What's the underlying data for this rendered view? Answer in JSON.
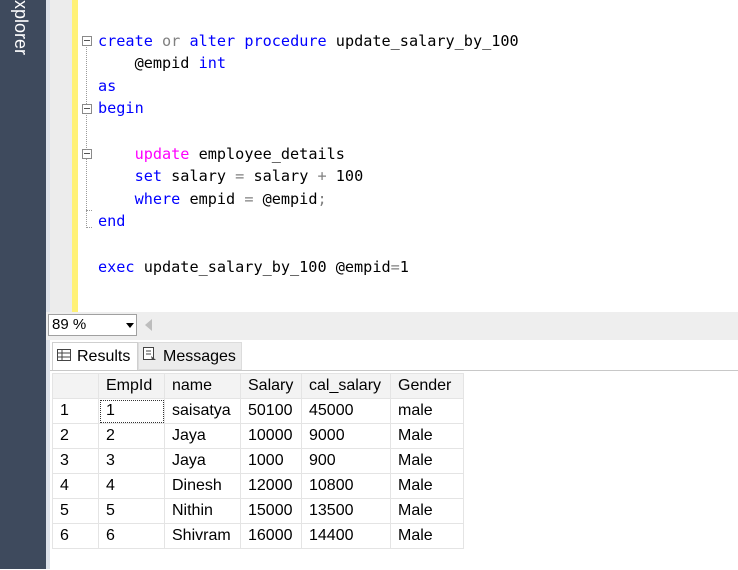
{
  "side_panel": {
    "label": "xplorer"
  },
  "editor": {
    "lines": [
      {
        "tokens": [
          {
            "t": "create",
            "c": "kw"
          },
          {
            "t": " "
          },
          {
            "t": "or",
            "c": "gr"
          },
          {
            "t": " "
          },
          {
            "t": "alter",
            "c": "kw"
          },
          {
            "t": " "
          },
          {
            "t": "procedure",
            "c": "kw"
          },
          {
            "t": " update_salary_by_100"
          }
        ]
      },
      {
        "tokens": [
          {
            "t": "    @empid "
          },
          {
            "t": "int",
            "c": "kw"
          }
        ]
      },
      {
        "tokens": [
          {
            "t": "as",
            "c": "kw"
          }
        ]
      },
      {
        "tokens": [
          {
            "t": "begin",
            "c": "kw"
          }
        ]
      },
      {
        "tokens": []
      },
      {
        "tokens": [
          {
            "t": "    "
          },
          {
            "t": "update",
            "c": "mg"
          },
          {
            "t": " employee_details"
          }
        ]
      },
      {
        "tokens": [
          {
            "t": "    "
          },
          {
            "t": "set",
            "c": "kw"
          },
          {
            "t": " salary "
          },
          {
            "t": "=",
            "c": "gr"
          },
          {
            "t": " salary "
          },
          {
            "t": "+",
            "c": "gr"
          },
          {
            "t": " 100"
          }
        ]
      },
      {
        "tokens": [
          {
            "t": "    "
          },
          {
            "t": "where",
            "c": "kw"
          },
          {
            "t": " empid "
          },
          {
            "t": "=",
            "c": "gr"
          },
          {
            "t": " @empid"
          },
          {
            "t": ";",
            "c": "gr"
          }
        ]
      },
      {
        "tokens": [
          {
            "t": "end",
            "c": "kw"
          }
        ]
      },
      {
        "tokens": []
      },
      {
        "tokens": [
          {
            "t": "exec",
            "c": "kw"
          },
          {
            "t": " update_salary_by_100 @empid"
          },
          {
            "t": "=",
            "c": "gr"
          },
          {
            "t": "1"
          }
        ]
      }
    ]
  },
  "zoom": {
    "value": "89 %"
  },
  "tabs": {
    "results": "Results",
    "messages": "Messages"
  },
  "grid": {
    "columns": [
      "EmpId",
      "name",
      "Salary",
      "cal_salary",
      "Gender"
    ],
    "rows": [
      [
        "1",
        "1",
        "saisatya",
        "50100",
        "45000",
        "male"
      ],
      [
        "2",
        "2",
        "Jaya",
        "10000",
        "9000",
        "Male"
      ],
      [
        "3",
        "3",
        "Jaya",
        "1000",
        "900",
        "Male"
      ],
      [
        "4",
        "4",
        "Dinesh",
        "12000",
        "10800",
        "Male"
      ],
      [
        "5",
        "5",
        "Nithin",
        "15000",
        "13500",
        "Male"
      ],
      [
        "6",
        "6",
        "Shivram",
        "16000",
        "14400",
        "Male"
      ]
    ]
  }
}
